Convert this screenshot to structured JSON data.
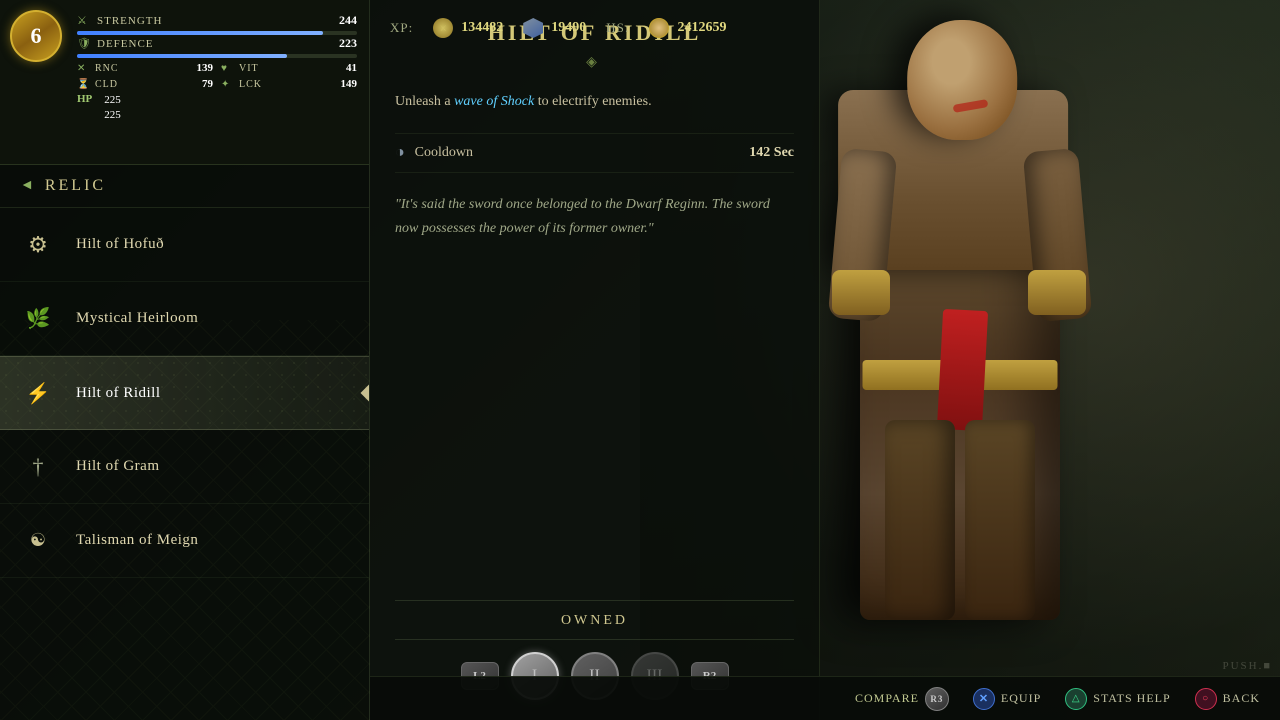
{
  "level": {
    "value": "6"
  },
  "stats": {
    "strength": {
      "label": "STRENGTH",
      "value": "244",
      "bar_pct": "88"
    },
    "defence": {
      "label": "DEFENCE",
      "value": "223",
      "bar_pct": "75"
    },
    "rnc": {
      "label": "RNC",
      "value": "139"
    },
    "vit": {
      "label": "VIT",
      "value": "41"
    },
    "cld": {
      "label": "CLD",
      "value": "79"
    },
    "lck": {
      "label": "LCK",
      "value": "149"
    },
    "hp": {
      "label": "HP",
      "current": "225",
      "max": "225"
    }
  },
  "category": {
    "label": "RELIC"
  },
  "xp": {
    "label": "XP:",
    "value1": "134482",
    "value2": "19490",
    "hs_label": "HS:",
    "hs_value": "2412659"
  },
  "items": [
    {
      "id": "hofud",
      "name": "Hilt of Hofuð",
      "icon": "⚙"
    },
    {
      "id": "mystical",
      "name": "Mystical Heirloom",
      "icon": "🌿"
    },
    {
      "id": "ridill",
      "name": "Hilt of Ridill",
      "icon": "⚡",
      "selected": true
    },
    {
      "id": "gram",
      "name": "Hilt of Gram",
      "icon": "†"
    },
    {
      "id": "talisman",
      "name": "Talisman of Meign",
      "icon": "☯"
    }
  ],
  "detail": {
    "title": "HILT OF RIDILL",
    "divider": "◈",
    "description_prefix": "Unleash a ",
    "description_highlight": "wave of Shock",
    "description_suffix": " to electrify enemies.",
    "cooldown_label": "Cooldown",
    "cooldown_value": "142 Sec",
    "lore": "\"It's said the sword once belonged to the Dwarf Reginn. The sword now possesses the power of its former owner.\"",
    "owned_label": "OWNED"
  },
  "upgrades": [
    {
      "id": "slot1",
      "label": "I",
      "active": true
    },
    {
      "id": "slot2",
      "label": "II",
      "active": false
    },
    {
      "id": "slot3",
      "label": "III",
      "active": false
    }
  ],
  "controls": {
    "l2": "L2",
    "r2": "R2",
    "compare": "COMPARE",
    "r3": "R3",
    "equip": "EQUIP",
    "stats_help": "STATS HELP",
    "back": "BACK"
  },
  "watermark": "PUSH.■"
}
